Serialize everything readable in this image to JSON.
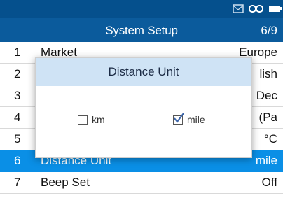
{
  "header": {
    "title": "System Setup",
    "page": "6/9"
  },
  "status_icons": [
    "mail-icon",
    "link-icon",
    "battery-icon"
  ],
  "colors": {
    "statusbar": "#05508d",
    "titlebar": "#0b5b9c",
    "selected_row": "#0a8fe6",
    "dialog_header": "#cfe3f5"
  },
  "rows": [
    {
      "num": "1",
      "label": "Market",
      "value": "Europe"
    },
    {
      "num": "2",
      "label": "",
      "value": "lish"
    },
    {
      "num": "3",
      "label": "",
      "value": "Dec"
    },
    {
      "num": "4",
      "label": "",
      "value": "(Pa"
    },
    {
      "num": "5",
      "label": "",
      "value": "°C"
    },
    {
      "num": "6",
      "label": "Distance Unit",
      "value": "mile"
    },
    {
      "num": "7",
      "label": "Beep Set",
      "value": "Off"
    }
  ],
  "dialog": {
    "title": "Distance Unit",
    "options": [
      {
        "label": "km",
        "checked": false
      },
      {
        "label": "mile",
        "checked": true
      }
    ]
  }
}
